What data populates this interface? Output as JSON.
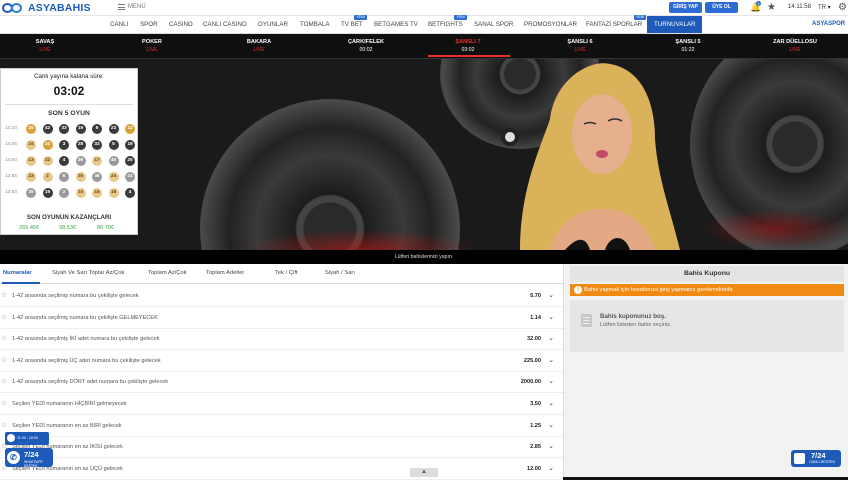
{
  "header": {
    "brand": "ASYABAHIS",
    "menu_label": "MENÜ",
    "login_label": "GİRİŞ YAP",
    "signup_label": "ÜYE OL",
    "notif_count": "1",
    "time": "14:11:58",
    "lang": "TR"
  },
  "nav": {
    "items": [
      {
        "label": "CANLI",
        "badge": ""
      },
      {
        "label": "SPOR",
        "badge": ""
      },
      {
        "label": "CASINO",
        "badge": ""
      },
      {
        "label": "CANLI CASINO",
        "badge": ""
      },
      {
        "label": "OYUNLAR",
        "badge": ""
      },
      {
        "label": "TOMBALA",
        "badge": ""
      },
      {
        "label": "TV BET",
        "badge": "YENİ"
      },
      {
        "label": "BETGAMES TV",
        "badge": ""
      },
      {
        "label": "BETFIGHTS",
        "badge": "YENİ"
      },
      {
        "label": "SANAL SPOR",
        "badge": ""
      },
      {
        "label": "PROMOSYONLAR",
        "badge": ""
      },
      {
        "label": "FANTAZİ SPORLAR",
        "badge": "YENİ"
      },
      {
        "label": "TURNUVALAR",
        "badge": ""
      }
    ],
    "brand_right": "ASYASPOR"
  },
  "games": [
    {
      "name": "SAVAŞ",
      "sub": "LIVE"
    },
    {
      "name": "POKER",
      "sub": "LIVE"
    },
    {
      "name": "BAKARA",
      "sub": "LIVE"
    },
    {
      "name": "ÇARKIFELEK",
      "sub": "00:02"
    },
    {
      "name": "ŞANSLI 7",
      "sub": "03:02"
    },
    {
      "name": "ŞANSLI 6",
      "sub": "LIVE"
    },
    {
      "name": "ŞANSLI 5",
      "sub": "01:22"
    },
    {
      "name": "ZAR DÜELLOSU",
      "sub": "LIVE"
    }
  ],
  "countdown": {
    "title": "Canlı yayına kalana süre:",
    "time": "03:02",
    "last5_title": "SON 5 OYUN",
    "rows": [
      {
        "time": "14:10",
        "balls": [
          [
            "25",
            "gold"
          ],
          [
            "42",
            "dark"
          ],
          [
            "33",
            "dark"
          ],
          [
            "19",
            "dark"
          ],
          [
            "9",
            "dark"
          ],
          [
            "23",
            "dark"
          ],
          [
            "12",
            "gold"
          ]
        ]
      },
      {
        "time": "14:05",
        "balls": [
          [
            "24",
            "light"
          ],
          [
            "10",
            "gold"
          ],
          [
            "3",
            "dark"
          ],
          [
            "28",
            "dark"
          ],
          [
            "33",
            "dark"
          ],
          [
            "5",
            "dark"
          ],
          [
            "19",
            "dark"
          ]
        ]
      },
      {
        "time": "14:00",
        "balls": [
          [
            "13",
            "light"
          ],
          [
            "32",
            "light"
          ],
          [
            "4",
            "dark"
          ],
          [
            "36",
            "grey"
          ],
          [
            "17",
            "light"
          ],
          [
            "40",
            "grey"
          ],
          [
            "25",
            "dark"
          ]
        ]
      },
      {
        "time": "13:55",
        "balls": [
          [
            "23",
            "light"
          ],
          [
            "2",
            "light"
          ],
          [
            "6",
            "grey"
          ],
          [
            "30",
            "light"
          ],
          [
            "36",
            "grey"
          ],
          [
            "24",
            "light"
          ],
          [
            "41",
            "grey"
          ]
        ]
      },
      {
        "time": "13:50",
        "balls": [
          [
            "35",
            "grey"
          ],
          [
            "19",
            "dark"
          ],
          [
            "2",
            "grey"
          ],
          [
            "10",
            "light"
          ],
          [
            "16",
            "light"
          ],
          [
            "18",
            "light"
          ],
          [
            "4",
            "dark"
          ]
        ]
      }
    ],
    "winnings_title": "SON OYUNUN KAZANÇLARI",
    "winnings": [
      "265.45€",
      "98.53€",
      "86.70€"
    ]
  },
  "stage": {
    "caption": "Lütfen bahislerinizi yapın."
  },
  "bets": {
    "tabs": [
      "Numaralar",
      "Siyah Ve Sarı Toplar Az/Çok",
      "Toplam Az/Çok",
      "Toplam Adetler",
      "Tek / Çift",
      "Siyah / Sarı"
    ],
    "rows": [
      {
        "text": "1-42 arasında seçilmiş numara bu çekilişte gelecek",
        "odd": "5.70"
      },
      {
        "text": "1-42 arasında seçilmiş numara bu çekilişte GELMEYECEK",
        "odd": "1.14"
      },
      {
        "text": "1-42 arasında seçilmiş İKİ adet numara bu çekilişte gelecek",
        "odd": "32.00"
      },
      {
        "text": "1-42 arasında seçilmiş ÜÇ adet numara bu çekilişte gelecek",
        "odd": "225.00"
      },
      {
        "text": "1-42 arasında seçilmiş DÖRT adet numara bu çekilişte gelecek",
        "odd": "2000.00"
      },
      {
        "text": "Seçilen YEDİ numaranın HİÇBİRİ gelmeyecek",
        "odd": "3.50"
      },
      {
        "text": "Seçilen YEDİ numaranın en az BİRİ gelecek",
        "odd": "1.25"
      },
      {
        "text": "Seçilen YEDİ numaranın en az İKİSİ gelecek",
        "odd": "2.85"
      },
      {
        "text": "Seçilen YEDİ numaranın en az ÜÇÜ gelecek",
        "odd": "12.00"
      }
    ]
  },
  "coupon": {
    "title": "Bahis Kuponu",
    "warning": "Bahis yapmak için hesabınıza giriş yapmanız gerekmektedir.",
    "empty_title": "Bahis kuponunuz boş.",
    "empty_sub": "Lütfen listeden bahis seçiniz."
  },
  "chat": {
    "hours": "11:00 - 18:00",
    "wa_title": "7/24",
    "wa_sub": "WHATSAPP DESTEK",
    "support_title": "7/24",
    "support_sub": "CANLI DESTEK"
  }
}
